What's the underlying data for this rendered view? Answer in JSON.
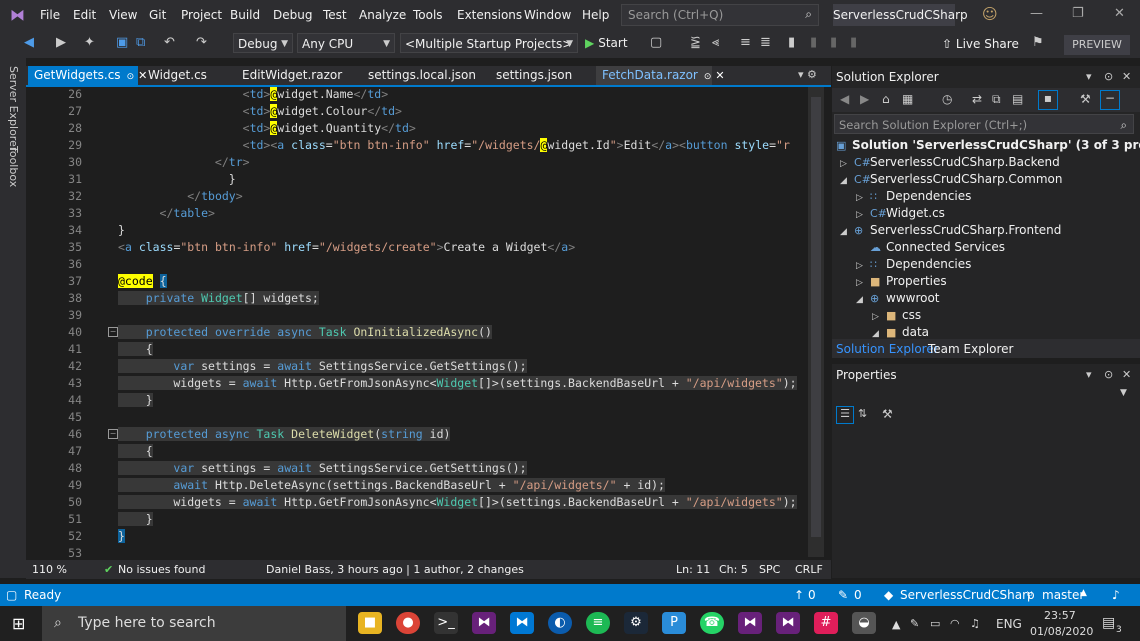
{
  "menu": [
    "File",
    "Edit",
    "View",
    "Git",
    "Project",
    "Build",
    "Debug",
    "Test",
    "Analyze",
    "Tools",
    "Extensions",
    "Window",
    "Help"
  ],
  "search_placeholder": "Search (Ctrl+Q)",
  "solution_title": "ServerlessCrudCSharp",
  "toolbar": {
    "config": "Debug",
    "platform": "Any CPU",
    "startup": "<Multiple Startup Projects>",
    "start": "Start",
    "live_share": "Live Share",
    "preview": "PREVIEW"
  },
  "side_rail": [
    "Server Explorer",
    "Toolbox"
  ],
  "tabs": [
    "GetWidgets.cs",
    "Widget.cs",
    "EditWidget.razor",
    "settings.local.json",
    "settings.json",
    "FetchData.razor"
  ],
  "code_lines": [
    {
      "n": "26",
      "t": ""
    },
    {
      "n": "27",
      "t": ""
    },
    {
      "n": "28",
      "t": ""
    },
    {
      "n": "29",
      "t": ""
    },
    {
      "n": "30",
      "t": ""
    },
    {
      "n": "31",
      "t": ""
    },
    {
      "n": "32",
      "t": ""
    },
    {
      "n": "33",
      "t": ""
    },
    {
      "n": "34",
      "t": ""
    },
    {
      "n": "35",
      "t": ""
    },
    {
      "n": "36",
      "t": ""
    },
    {
      "n": "37",
      "t": ""
    },
    {
      "n": "38",
      "t": ""
    },
    {
      "n": "39",
      "t": ""
    },
    {
      "n": "40",
      "t": ""
    },
    {
      "n": "41",
      "t": ""
    },
    {
      "n": "42",
      "t": ""
    },
    {
      "n": "43",
      "t": ""
    },
    {
      "n": "44",
      "t": ""
    },
    {
      "n": "45",
      "t": ""
    },
    {
      "n": "46",
      "t": ""
    },
    {
      "n": "47",
      "t": ""
    },
    {
      "n": "48",
      "t": ""
    },
    {
      "n": "49",
      "t": ""
    },
    {
      "n": "50",
      "t": ""
    },
    {
      "n": "51",
      "t": ""
    },
    {
      "n": "52",
      "t": ""
    },
    {
      "n": "53",
      "t": ""
    }
  ],
  "editor_status": {
    "zoom": "110 %",
    "issues": "No issues found",
    "blame": "Daniel Bass, 3 hours ago | 1 author, 2 changes",
    "ln": "Ln: 11",
    "ch": "Ch: 5",
    "spc": "SPC",
    "crlf": "CRLF"
  },
  "solution_explorer": {
    "title": "Solution Explorer",
    "search_placeholder": "Search Solution Explorer (Ctrl+;)",
    "nodes": [
      "Solution 'ServerlessCrudCSharp' (3 of 3 projects)",
      "ServerlessCrudCSharp.Backend",
      "ServerlessCrudCSharp.Common",
      "Dependencies",
      "Widget.cs",
      "ServerlessCrudCSharp.Frontend",
      "Connected Services",
      "Dependencies",
      "Properties",
      "wwwroot",
      "css",
      "data"
    ],
    "tab_active": "Solution Explorer",
    "tab_other": "Team Explorer"
  },
  "properties_title": "Properties",
  "statusbar": {
    "ready": "Ready",
    "up": "0",
    "pencil": "0",
    "repo": "ServerlessCrudCSharp",
    "branch": "master"
  },
  "taskbar": {
    "search": "Type here to search",
    "lang": "ENG",
    "time": "23:57",
    "date": "01/08/2020",
    "notif": "3"
  }
}
